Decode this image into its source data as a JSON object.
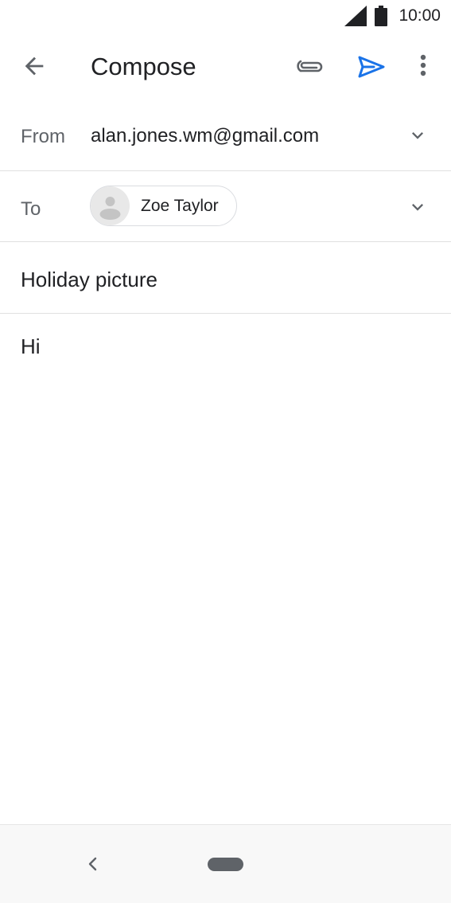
{
  "status_bar": {
    "time": "10:00",
    "icons": [
      "signal-icon",
      "battery-icon"
    ]
  },
  "app_bar": {
    "title": "Compose",
    "icons": [
      "back-arrow-icon",
      "paperclip-icon",
      "send-icon",
      "more-vert-icon"
    ],
    "accent_color": "#1a73e8"
  },
  "from": {
    "label": "From",
    "value": "alan.jones.wm@gmail.com"
  },
  "to": {
    "label": "To",
    "recipients": [
      {
        "name": "Zoe Taylor",
        "icon": "person-icon"
      }
    ]
  },
  "subject": {
    "value": "Holiday picture"
  },
  "body": {
    "value": "Hi"
  },
  "nav_bar": {
    "icons": [
      "nav-back-icon",
      "nav-home-pill"
    ]
  }
}
